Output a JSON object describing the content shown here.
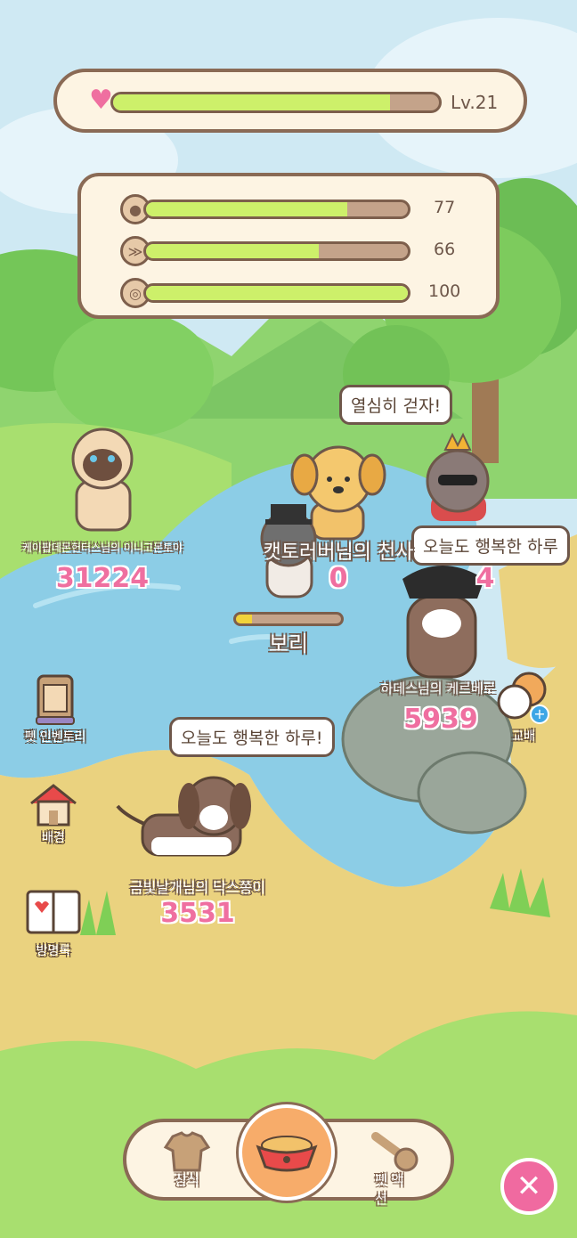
{
  "hud": {
    "level": "Lv.21",
    "xp_fraction": 0.85,
    "stats": [
      {
        "icon": "pet-face-icon",
        "value": "77",
        "fraction": 0.77
      },
      {
        "icon": "fish-icon",
        "value": "66",
        "fraction": 0.66
      },
      {
        "icon": "yarn-ball-icon",
        "value": "100",
        "fraction": 1.0
      }
    ]
  },
  "pets": [
    {
      "id": "siamese-cat",
      "name": "케이팝데몬헌터스님의 이니고몬토야",
      "score": "31224"
    },
    {
      "id": "golden-puppy",
      "name": "캣토러버님의 천사",
      "score": "0"
    },
    {
      "id": "bori",
      "name": "보리",
      "progress": 0.15
    },
    {
      "id": "crown-cat",
      "score": "4"
    },
    {
      "id": "pirate-shiba",
      "name": "하데스님의 케르베로",
      "score": "5939"
    },
    {
      "id": "dachshund",
      "name": "금빛날개님의 닥스쫑이",
      "score": "3531"
    }
  ],
  "bubbles": {
    "puppy": "열심히 걷자!",
    "crown_cat": "오늘도 행복한 하루",
    "dachshund": "오늘도 행복한 하루!"
  },
  "side_menu": {
    "inventory": "펫 인벤토리",
    "background": "배경",
    "guestbook": "방명록",
    "exchange": "교배"
  },
  "bottom_nav": {
    "decorate": "장식",
    "pet_action": "펫 액션"
  },
  "colors": {
    "bar_fill": "#cdf06a",
    "score_pink": "#ef6fa0",
    "close_button": "#f06aa0"
  }
}
